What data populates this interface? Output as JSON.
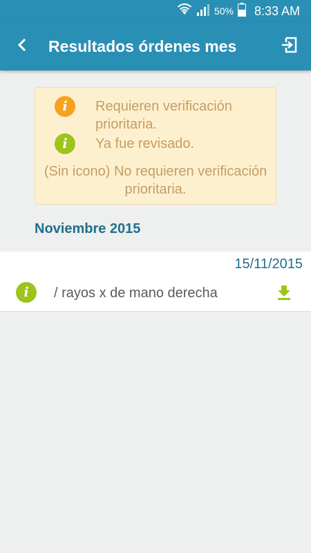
{
  "status_bar": {
    "battery_percent": "50%",
    "time": "8:33 AM",
    "icons": [
      "wifi-icon",
      "signal-icon",
      "battery-icon"
    ]
  },
  "header": {
    "title": "Resultados órdenes mes",
    "back_icon": "chevron-left-icon",
    "exit_icon": "exit-icon"
  },
  "legend": {
    "items": [
      {
        "icon": "info-icon",
        "color": "#f6a21f",
        "text": "Requieren verificación prioritaria."
      },
      {
        "icon": "info-icon",
        "color": "#9cc41c",
        "text": "Ya fue revisado."
      }
    ],
    "no_icon_text": "(Sin icono) No requieren verificación prioritaria."
  },
  "section": {
    "month": "Noviembre 2015"
  },
  "results": [
    {
      "date": "15/11/2015",
      "status_color": "#9cc41c",
      "name": "/ rayos x de mano derecha",
      "action_icon": "download-icon"
    }
  ],
  "colors": {
    "primary": "#2a8fb5",
    "accent_green": "#9cc41c",
    "accent_orange": "#f6a21f",
    "legend_bg": "#fdf0cf"
  },
  "icon_glyph": "i"
}
